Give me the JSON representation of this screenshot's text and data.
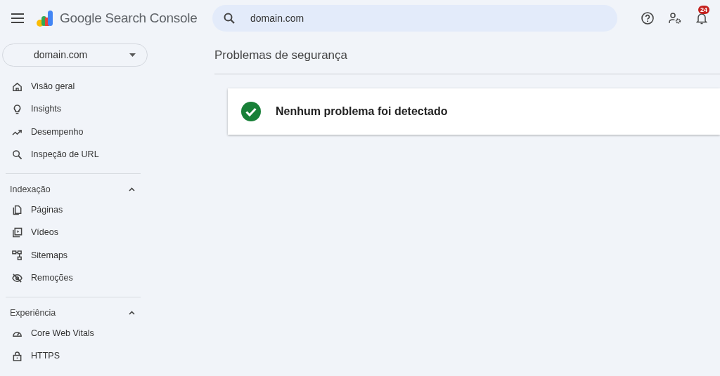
{
  "app": {
    "title": "Google Search Console"
  },
  "search": {
    "value": "domain.com"
  },
  "notifications": {
    "count": "24"
  },
  "property_selector": {
    "value": "domain.com"
  },
  "sidebar": {
    "groups": [
      {
        "items": [
          {
            "label": "Visão geral"
          },
          {
            "label": "Insights"
          },
          {
            "label": "Desempenho"
          },
          {
            "label": "Inspeção de URL"
          }
        ]
      },
      {
        "header": "Indexação",
        "expanded": true,
        "items": [
          {
            "label": "Páginas"
          },
          {
            "label": "Vídeos"
          },
          {
            "label": "Sitemaps"
          },
          {
            "label": "Remoções"
          }
        ]
      },
      {
        "header": "Experiência",
        "expanded": true,
        "items": [
          {
            "label": "Core Web Vitals"
          },
          {
            "label": "HTTPS"
          }
        ]
      }
    ]
  },
  "page": {
    "title": "Problemas de segurança",
    "status": {
      "kind": "ok",
      "message": "Nenhum problema foi detectado"
    }
  }
}
